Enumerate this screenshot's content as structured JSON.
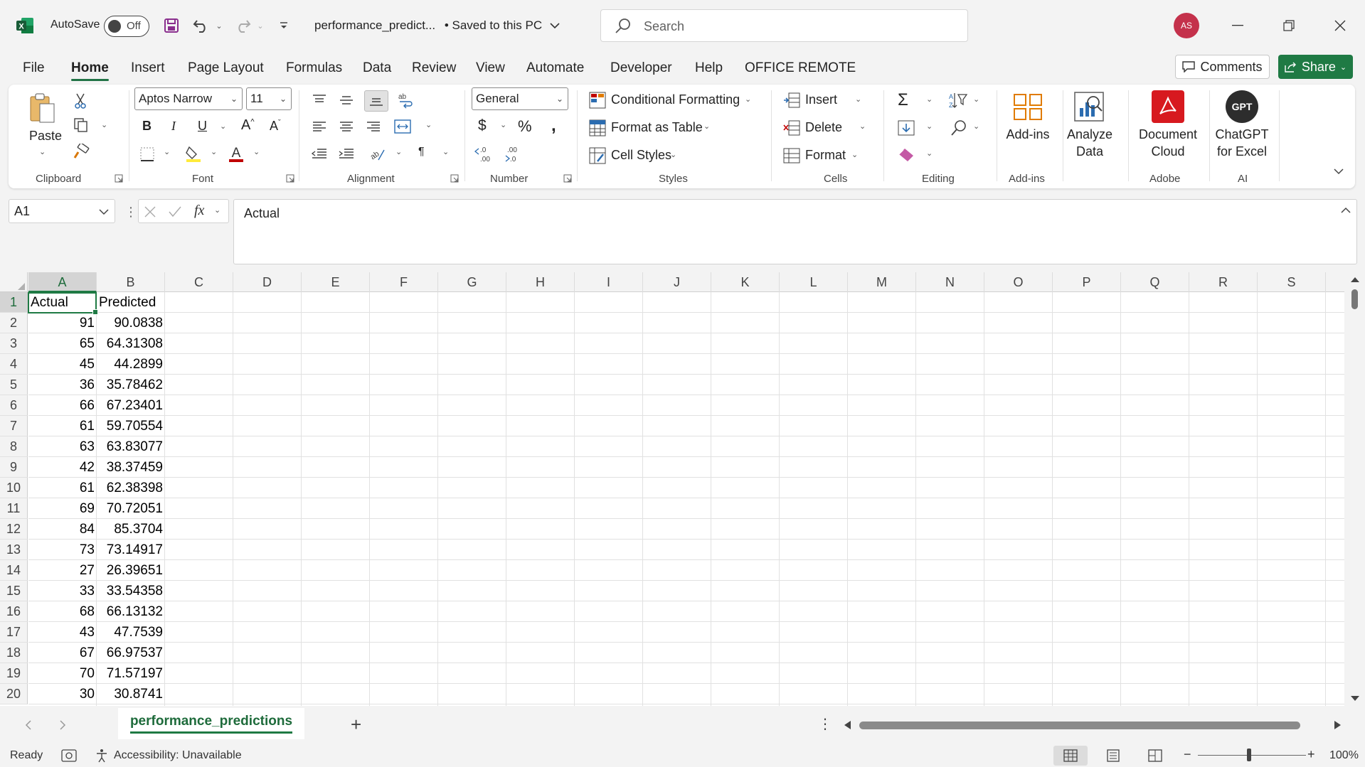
{
  "title_bar": {
    "autosave_label": "AutoSave",
    "autosave_state": "Off",
    "document_title": "performance_predict...",
    "save_status": "• Saved to this PC",
    "search_placeholder": "Search",
    "user_initials": "AS",
    "accent_color": "#217346"
  },
  "menu": {
    "tabs": [
      "File",
      "Home",
      "Insert",
      "Page Layout",
      "Formulas",
      "Data",
      "Review",
      "View",
      "Automate",
      "Developer",
      "Help",
      "OFFICE REMOTE"
    ],
    "active_tab": "Home",
    "comments_label": "Comments",
    "share_label": "Share"
  },
  "ribbon": {
    "clipboard": {
      "paste_label": "Paste",
      "group_label": "Clipboard"
    },
    "font": {
      "font_name": "Aptos Narrow",
      "font_size": "11",
      "group_label": "Font"
    },
    "alignment": {
      "group_label": "Alignment"
    },
    "number": {
      "format": "General",
      "group_label": "Number"
    },
    "styles": {
      "conditional_formatting": "Conditional Formatting",
      "format_as_table": "Format as Table",
      "cell_styles": "Cell Styles",
      "group_label": "Styles"
    },
    "cells": {
      "insert": "Insert",
      "delete": "Delete",
      "format": "Format",
      "group_label": "Cells"
    },
    "editing": {
      "group_label": "Editing"
    },
    "addins": {
      "label": "Add-ins",
      "group_label": "Add-ins"
    },
    "analyze": {
      "label_line1": "Analyze",
      "label_line2": "Data"
    },
    "adobe": {
      "label_line1": "Document",
      "label_line2": "Cloud",
      "group_label": "Adobe"
    },
    "ai": {
      "label_line1": "ChatGPT",
      "label_line2": "for Excel",
      "badge": "GPT",
      "group_label": "AI"
    }
  },
  "formula_bar": {
    "name_box": "A1",
    "fx_label": "fx",
    "content": "Actual"
  },
  "sheet": {
    "columns": [
      "A",
      "B",
      "C",
      "D",
      "E",
      "F",
      "G",
      "H",
      "I",
      "J",
      "K",
      "L",
      "M",
      "N",
      "O",
      "P",
      "Q",
      "R",
      "S"
    ],
    "row_numbers": [
      "1",
      "2",
      "3",
      "4",
      "5",
      "6",
      "7",
      "8",
      "9",
      "10",
      "11",
      "12",
      "13",
      "14",
      "15",
      "16",
      "17",
      "18",
      "19",
      "20"
    ],
    "header": [
      "Actual",
      "Predicted"
    ],
    "rows": [
      [
        "91",
        "90.0838"
      ],
      [
        "65",
        "64.31308"
      ],
      [
        "45",
        "44.2899"
      ],
      [
        "36",
        "35.78462"
      ],
      [
        "66",
        "67.23401"
      ],
      [
        "61",
        "59.70554"
      ],
      [
        "63",
        "63.83077"
      ],
      [
        "42",
        "38.37459"
      ],
      [
        "61",
        "62.38398"
      ],
      [
        "69",
        "70.72051"
      ],
      [
        "84",
        "85.3704"
      ],
      [
        "73",
        "73.14917"
      ],
      [
        "27",
        "26.39651"
      ],
      [
        "33",
        "33.54358"
      ],
      [
        "68",
        "66.13132"
      ],
      [
        "43",
        "47.7539"
      ],
      [
        "67",
        "66.97537"
      ],
      [
        "70",
        "71.57197"
      ],
      [
        "30",
        "30.8741"
      ]
    ],
    "active_cell": "A1"
  },
  "sheet_tabs": {
    "active": "performance_predictions",
    "add_label": "+"
  },
  "status_bar": {
    "ready": "Ready",
    "accessibility": "Accessibility: Unavailable",
    "zoom": "100%",
    "zoom_minus": "−",
    "zoom_plus": "+"
  }
}
